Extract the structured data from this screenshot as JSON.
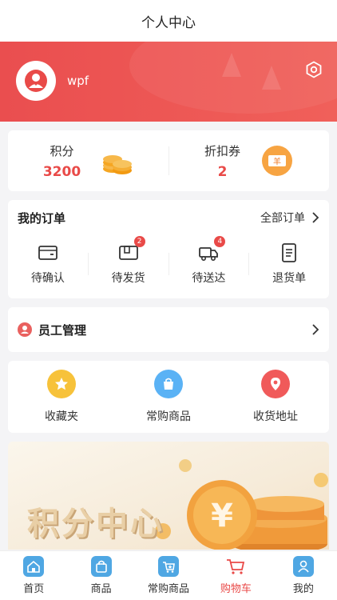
{
  "nav": {
    "title": "个人中心"
  },
  "profile": {
    "username": "wpf"
  },
  "stats": {
    "points_label": "积分",
    "points_value": "3200",
    "coupon_label": "折扣券",
    "coupon_value": "2",
    "coupon_icon_text": "羊"
  },
  "orders": {
    "title": "我的订单",
    "all_label": "全部订单",
    "items": [
      {
        "label": "待确认",
        "badge": ""
      },
      {
        "label": "待发货",
        "badge": "2"
      },
      {
        "label": "待送达",
        "badge": "4"
      },
      {
        "label": "退货单",
        "badge": ""
      }
    ]
  },
  "staff": {
    "label": "员工管理"
  },
  "quick": [
    {
      "label": "收藏夹",
      "color": "#f7c23a"
    },
    {
      "label": "常购商品",
      "color": "#5ab2f5"
    },
    {
      "label": "收货地址",
      "color": "#f05a5a"
    }
  ],
  "banner": {
    "text": "积分中心",
    "coin_symbol": "¥"
  },
  "tabs": [
    {
      "label": "首页",
      "active": false
    },
    {
      "label": "商品",
      "active": false
    },
    {
      "label": "常购商品",
      "active": false
    },
    {
      "label": "购物车",
      "active": true
    },
    {
      "label": "我的",
      "active": false
    }
  ],
  "colors": {
    "brand": "#e94a48",
    "tab_icon": "#4fa7e3"
  }
}
